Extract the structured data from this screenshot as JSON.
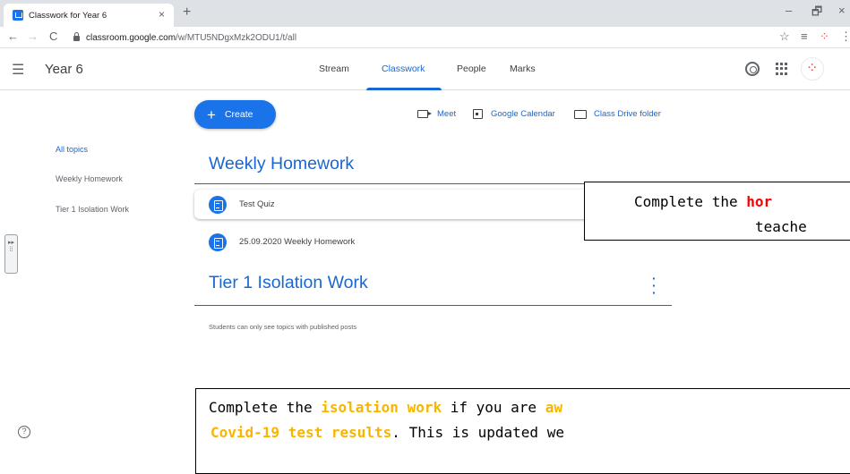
{
  "browser": {
    "tab_title": "Classwork for Year 6",
    "tab_close": "×",
    "new_tab": "+",
    "window_minimize": "–",
    "window_maximize": "🗗",
    "window_close": "×",
    "url_host": "classroom.google.com",
    "url_path": "/w/MTU5NDgxMzk2ODU1/t/all"
  },
  "header": {
    "class_name": "Year 6",
    "tabs": [
      {
        "label": "Stream"
      },
      {
        "label": "Classwork"
      },
      {
        "label": "People"
      },
      {
        "label": "Marks"
      }
    ],
    "active_tab": "Classwork"
  },
  "toolbar": {
    "create_label": "Create",
    "meet_label": "Meet",
    "calendar_label": "Google Calendar",
    "drive_label": "Class Drive folder"
  },
  "topics": {
    "items": [
      {
        "label": "All topics"
      },
      {
        "label": "Weekly Homework"
      },
      {
        "label": "Tier 1 Isolation Work"
      }
    ],
    "active": "All topics"
  },
  "sections": [
    {
      "title": "Weekly Homework",
      "assignments": [
        {
          "title": "Test Quiz"
        },
        {
          "title": "25.09.2020 Weekly Homework"
        }
      ]
    },
    {
      "title": "Tier 1 Isolation Work",
      "assignments": []
    }
  ],
  "students_note": "Students can only see topics with published posts",
  "callouts": {
    "homework": {
      "line1_pre": "Complete the ",
      "line1_hl": "hor",
      "line2": "teache"
    },
    "isolation": {
      "line1_pre": "Complete the ",
      "line1_hl": "isolation work",
      "line1_mid": " if you are ",
      "line1_hl2": "aw",
      "line2_hl": "Covid-19 test results",
      "line2_post": ". This is updated we"
    }
  },
  "colors": {
    "accent": "#1967d2",
    "button": "#1a73e8",
    "highlight_red": "#ff0000",
    "highlight_orange": "#f7b500"
  }
}
